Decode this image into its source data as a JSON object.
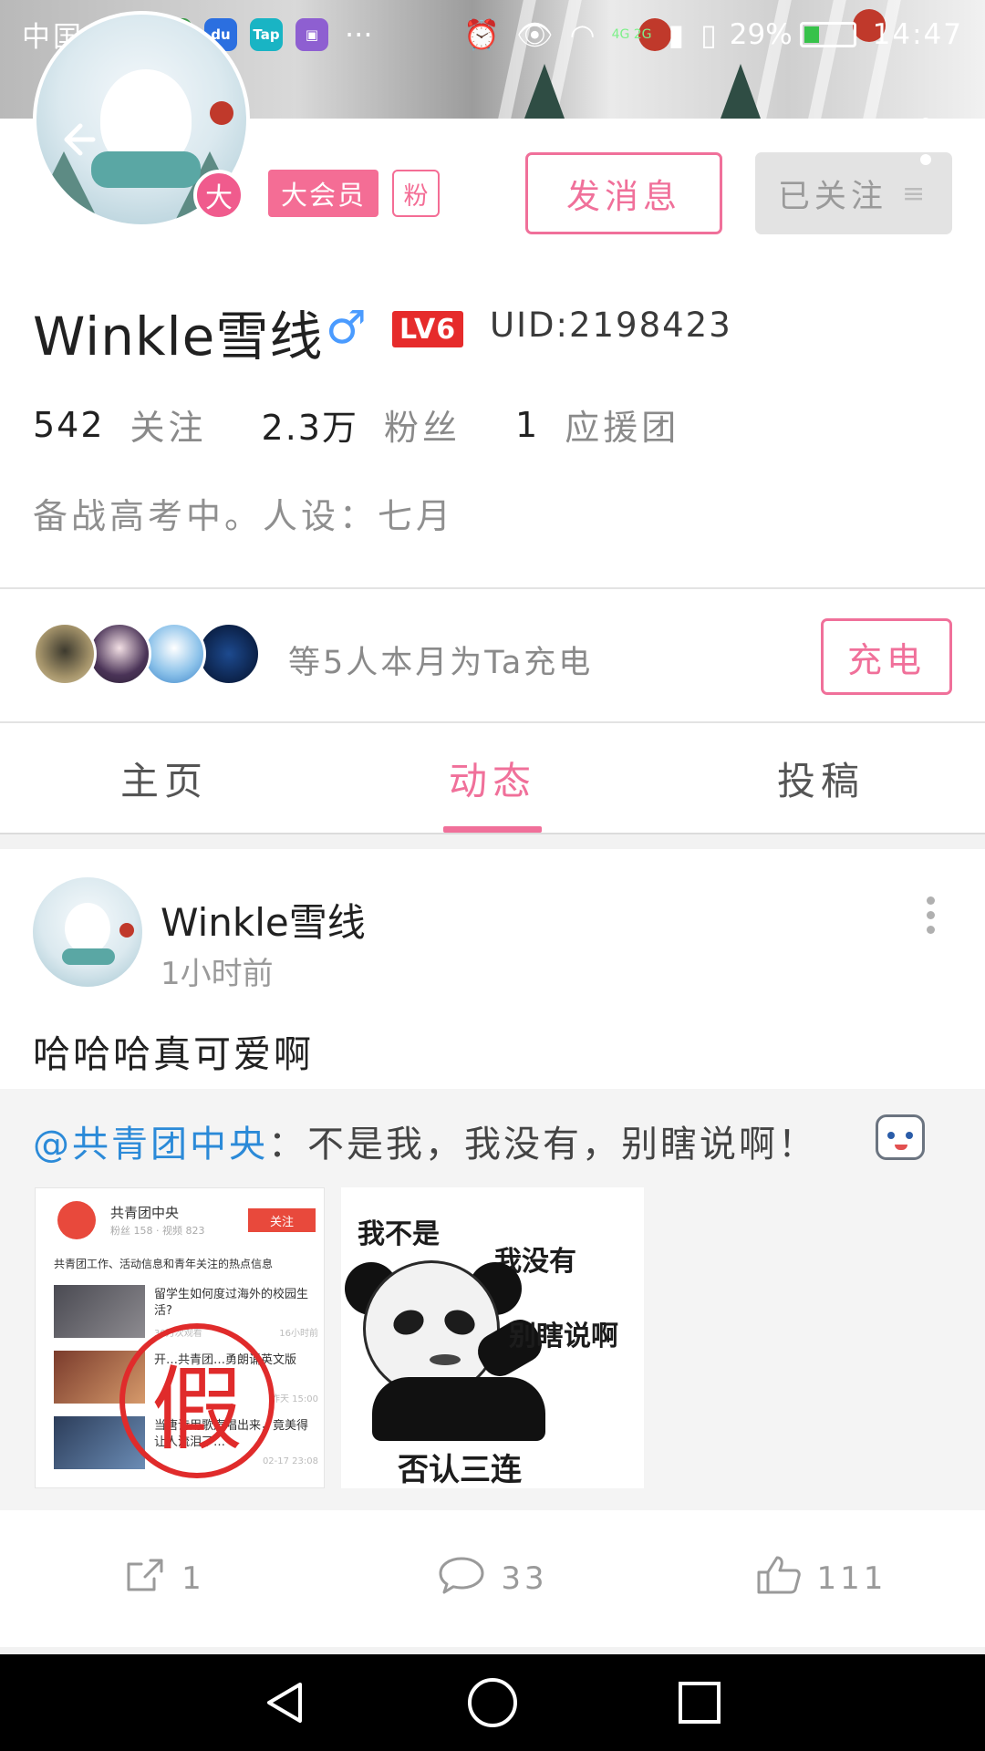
{
  "status_bar": {
    "carrier": "中国电信",
    "app_icons": [
      "Tap"
    ],
    "more": "···",
    "network": "4G 2G",
    "battery": "29%",
    "time": "14:47"
  },
  "header": {
    "back_icon": "back-arrow-icon",
    "more_icon": "more-vertical-icon"
  },
  "profile": {
    "vip_dot": "大",
    "vip_badge": "大会员",
    "fan_badge": "粉",
    "message_button": "发消息",
    "follow_button": "已关注",
    "username": "Winkle雪线",
    "gender": "♂",
    "level": "LV6",
    "uid": "UID:2198423",
    "stats": [
      {
        "num": "542",
        "label": "关注"
      },
      {
        "num": "2.3万",
        "label": "粉丝"
      },
      {
        "num": "1",
        "label": "应援团"
      }
    ],
    "bio": "备战高考中。人设：七月"
  },
  "charge": {
    "text": "等5人本月为Ta充电",
    "button": "充电"
  },
  "tabs": [
    {
      "label": "主页",
      "active": false
    },
    {
      "label": "动态",
      "active": true
    },
    {
      "label": "投稿",
      "active": false
    }
  ],
  "post": {
    "author": "Winkle雪线",
    "time": "1小时前",
    "text": "哈哈哈真可爱啊",
    "repost": {
      "mention": "@共青团中央",
      "colon": "：",
      "text": "不是我，我没有，别瞎说啊！"
    },
    "image1": {
      "name": "共青团中央",
      "meta": "粉丝 158 · 视频 823",
      "follow": "关注",
      "intro": "共青团工作、活动信息和青年关注的热点信息",
      "rows": [
        {
          "title": "留学生如何度过海外的校园生活?",
          "meta": "30万次观看",
          "time": "16小时前"
        },
        {
          "title": "开…共青团…勇朗诵英文版",
          "meta": "",
          "time": "昨天 15:00"
        },
        {
          "title": "当唐诗用歌声唱出来，竟美得让人流泪了…",
          "meta": "",
          "time": "02-17 23:08"
        }
      ],
      "stamp": "假"
    },
    "image2": {
      "lines": [
        "我不是",
        "我没有",
        "别瞎说啊",
        "否认三连"
      ]
    },
    "actions": [
      {
        "icon": "share-icon",
        "count": "1"
      },
      {
        "icon": "comment-icon",
        "count": "33"
      },
      {
        "icon": "like-icon",
        "count": "111"
      }
    ]
  },
  "navbar": {
    "back": "nav-back-icon",
    "home": "nav-home-icon",
    "recents": "nav-recents-icon"
  },
  "colors": {
    "accent": "#f0709a",
    "vip": "#f46d95",
    "mention": "#2b8ad8",
    "level": "#e62b2b"
  }
}
